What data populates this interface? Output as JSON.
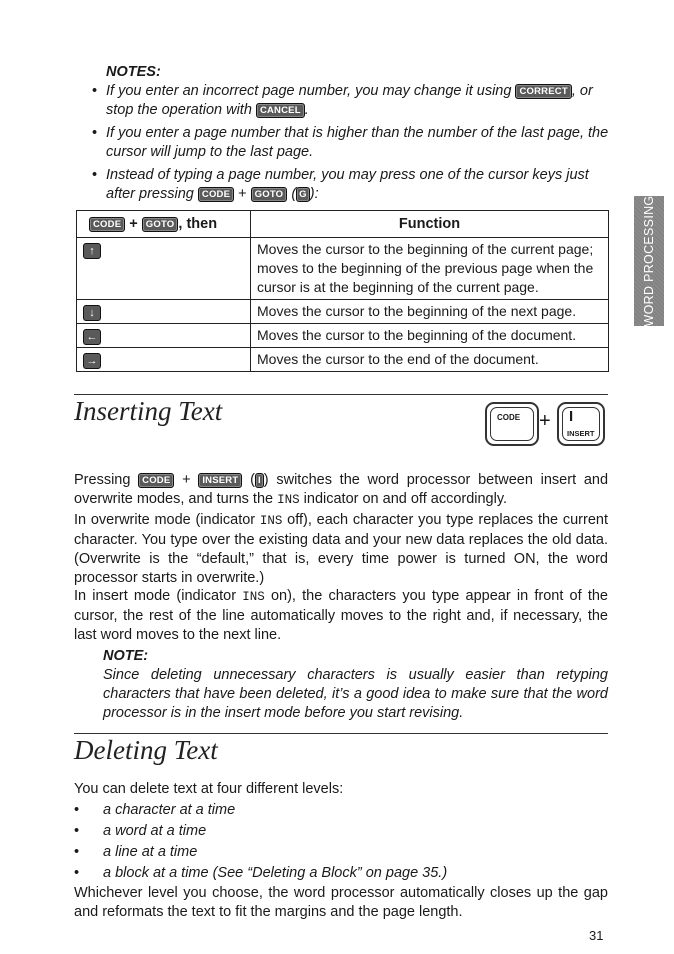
{
  "notes": {
    "title": "NOTES:",
    "items": [
      {
        "before": "If you enter an incorrect page number, you may change it using ",
        "key1": "CORRECT",
        "mid": ", or stop the operation with ",
        "key2": "CANCEL",
        "after": "."
      },
      {
        "text": "If you enter a page number that is higher than the number of the last page, the cursor will jump to the last page."
      },
      {
        "before": "Instead of typing a page number, you may press one of the cursor keys just after pressing ",
        "key1": "CODE",
        "plus": "+",
        "key2": "GOTO",
        "paren_open": "(",
        "key3": "G",
        "paren_close": "):"
      }
    ]
  },
  "table": {
    "header": {
      "key1": "CODE",
      "plus": "+",
      "key2": "GOTO",
      "suffix": ", then",
      "function": "Function"
    },
    "rows": [
      {
        "key_icon": "up-arrow",
        "glyph": "↑",
        "function": "Moves the cursor to the beginning of the current page; moves to the beginning of the previous page when the cursor is at the beginning of the current page."
      },
      {
        "key_icon": "down-arrow",
        "glyph": "↓",
        "function": "Moves the cursor to the beginning of the next page."
      },
      {
        "key_icon": "left-arrow",
        "glyph": "←",
        "function": "Moves the cursor to the beginning of the document."
      },
      {
        "key_icon": "right-arrow",
        "glyph": "→",
        "function": "Moves the cursor to the end of the document."
      }
    ]
  },
  "side_tab": {
    "label": "WORD PROCESSING"
  },
  "inserting": {
    "heading": "Inserting Text",
    "keys_graphic": {
      "key1": "CODE",
      "plus": "+",
      "key2_top": "I",
      "key2_bottom": "INSERT"
    },
    "p1": {
      "before": "Pressing ",
      "key1": "CODE",
      "plus": "+",
      "key2": "INSERT",
      "paren_open": "(",
      "key3": "I",
      "after": ") switches the word processor between insert and overwrite modes, and turns the ",
      "ins": "INS",
      "after2": " indicator on and off accordingly."
    },
    "p2": {
      "before": "In overwrite mode (indicator ",
      "ins": "INS",
      "after": " off), each character you type replaces the current character. You type over the existing data and your new data replaces the old data. (Overwrite is the “default,” that is, every time power is turned ON, the word processor starts in overwrite.)"
    },
    "p3": {
      "before": "In insert mode (indicator ",
      "ins": "INS",
      "after": " on), the characters you type appear in front of the cursor, the rest of the line automatically moves to the right and, if necessary, the last word moves to the next line."
    },
    "note": {
      "title": "NOTE:",
      "text": "Since deleting unnecessary characters is usually easier than retyping characters that have been deleted, it’s a good idea to make sure that the word processor is in the insert mode before you start revising."
    }
  },
  "deleting": {
    "heading": "Deleting Text",
    "intro": "You can delete text at four different levels:",
    "bullet": "•",
    "items": [
      "a character at a time",
      "a word at a time",
      "a line at a time",
      "a block at a time (See “Deleting a Block” on page 35.)"
    ],
    "outro": "Whichever level you choose, the word processor automatically closes up the gap and reformats the text to fit the margins and the page length."
  },
  "page_number": "31"
}
